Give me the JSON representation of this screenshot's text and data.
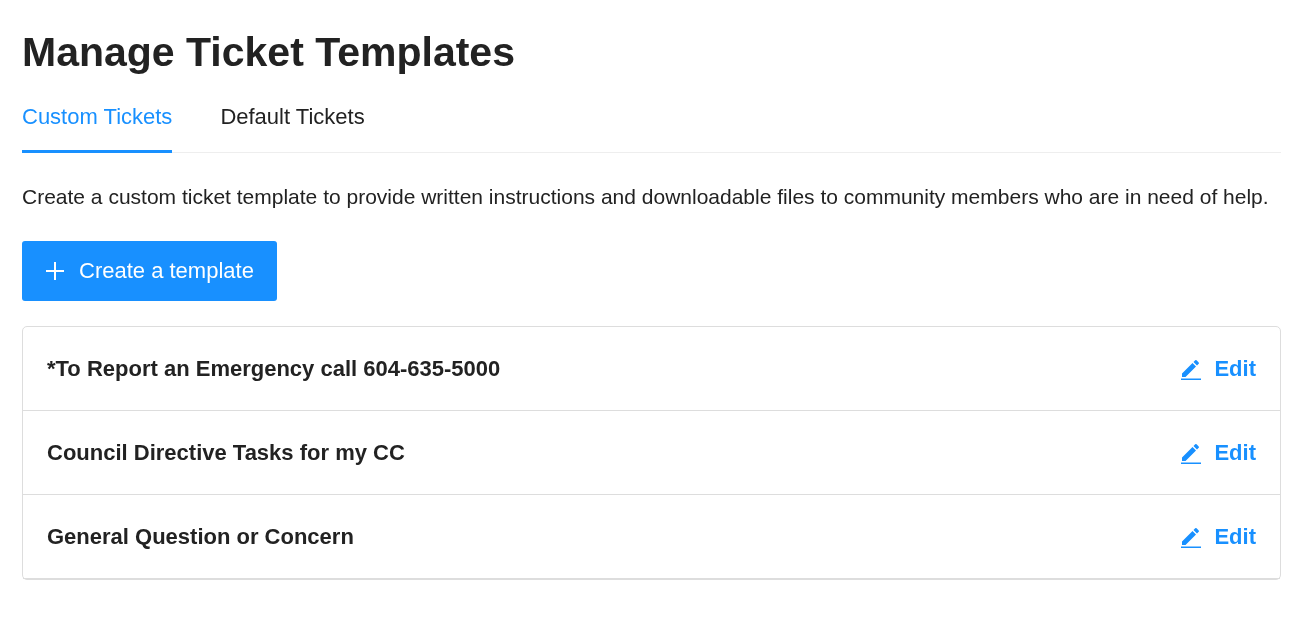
{
  "title": "Manage Ticket Templates",
  "tabs": [
    {
      "label": "Custom Tickets",
      "selected": true
    },
    {
      "label": "Default Tickets",
      "selected": false
    }
  ],
  "description": "Create a custom ticket template to provide written instructions and downloadable files to community members who are in need of help.",
  "create_button": {
    "label": "Create a template"
  },
  "templates": [
    {
      "name": "*To Report an Emergency call 604-635-5000",
      "action": "Edit"
    },
    {
      "name": "Council Directive Tasks for my CC",
      "action": "Edit"
    },
    {
      "name": "General Question or Concern",
      "action": "Edit"
    }
  ]
}
